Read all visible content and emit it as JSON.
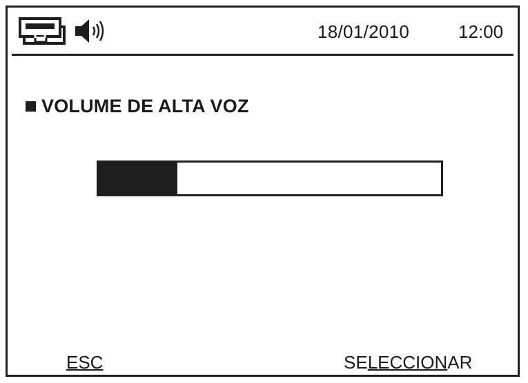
{
  "status_bar": {
    "network_icon": "network-connection-icon",
    "speaker_icon": "speaker-volume-icon",
    "date": "18/01/2010",
    "time": "12:00"
  },
  "screen": {
    "title": "VOLUME DE ALTA VOZ",
    "volume_level_fraction": 0.23
  },
  "softkeys": {
    "left": "ESC",
    "right_prefix": "SE",
    "right_underlined": "LECCION",
    "right_suffix": "AR"
  }
}
